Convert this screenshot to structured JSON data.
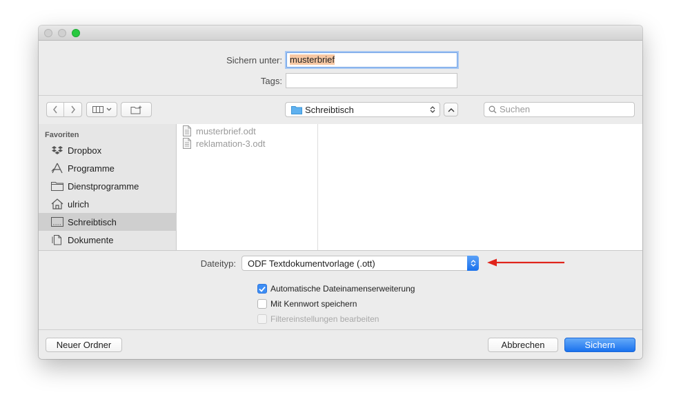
{
  "window": {
    "save_as_label": "Sichern unter:",
    "save_as_value": "musterbrief",
    "tags_label": "Tags:",
    "tags_value": ""
  },
  "toolbar": {
    "back_icon": "chevron-left-icon",
    "forward_icon": "chevron-right-icon",
    "view_icon": "column-view-icon",
    "new_folder_icon": "new-folder-icon",
    "location": "Schreibtisch",
    "search_placeholder": "Suchen"
  },
  "sidebar": {
    "heading": "Favoriten",
    "items": [
      {
        "label": "Dropbox",
        "icon": "dropbox-icon"
      },
      {
        "label": "Programme",
        "icon": "applications-icon"
      },
      {
        "label": "Dienstprogramme",
        "icon": "folder-icon"
      },
      {
        "label": "ulrich",
        "icon": "home-icon"
      },
      {
        "label": "Schreibtisch",
        "icon": "desktop-icon",
        "selected": true
      },
      {
        "label": "Dokumente",
        "icon": "documents-icon"
      }
    ]
  },
  "files": [
    {
      "name": "musterbrief.odt"
    },
    {
      "name": "reklamation-3.odt"
    }
  ],
  "options": {
    "filetype_label": "Dateityp:",
    "filetype_value": "ODF Textdokumentvorlage (.ott)",
    "checkboxes": [
      {
        "label": "Automatische Dateinamenserweiterung",
        "checked": true,
        "disabled": false
      },
      {
        "label": "Mit Kennwort speichern",
        "checked": false,
        "disabled": false
      },
      {
        "label": "Filtereinstellungen bearbeiten",
        "checked": false,
        "disabled": true
      }
    ]
  },
  "buttons": {
    "new_folder": "Neuer Ordner",
    "cancel": "Abbrechen",
    "save": "Sichern"
  },
  "colors": {
    "accent": "#1a72ee",
    "annotation_arrow": "#e0241b",
    "selection": "#f7c8a4"
  }
}
